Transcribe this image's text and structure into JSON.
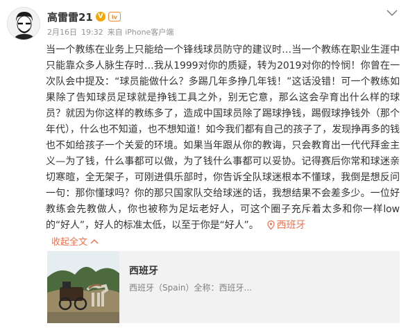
{
  "user": {
    "name": "高雷雷21",
    "verified_mark": "V",
    "level_badge": "lv",
    "avatar": "avatar-photo"
  },
  "meta": {
    "date": "2月16日",
    "time": "19:32",
    "source": "来自 iPhone客户端"
  },
  "post": {
    "text": "当一个教练在业务上只能给一个锋线球员防守的建议时…当一个教练在职业生涯中只能靠众多人脉生存时…我从1999对你的质疑，转为2019对你的怜悯！你曾在一次队会中提及：“球员能做什么？多踢几年多挣几年钱！”这话没错！可一个教练如果除了告知球员足球就是挣钱工具之外，别无它意，那么这会孕育出什么样的球员？就因为你这样的教练多了，造成中国球员除了踢球挣钱，踢假球挣钱外（那个年代），什么也不知道，也不想知道！如今我们都有自己的孩子了，发现挣再多的钱也不如给孩子一个关爱的环境。如果当年跟从你的教诲，只会教育出一代代拜金主义—为了钱，什么事都可以做，为了钱什么事都可以妥协。记得赛后你常和球迷亲切寒暄，全无架子，可刚进俱乐部时，你告诉全队球迷根本不懂球，我倒是想反问一句：那你懂球吗？你的那只国家队交给球迷的话，我想结果不会差多少。一位好教练会先教做人，你也被称为足坛老好人，可这个圈子充斥着太多和你一样low的“好人”，好人的标准太低，以至于你是“好人”。",
    "location": "西班牙",
    "expand_label": "收起全文"
  },
  "card": {
    "title": "西班牙",
    "description": "西班牙（Spain）全称：西班牙..."
  },
  "icons": {
    "top_right": "chevron-down-icon",
    "location": "location-pin-icon",
    "collapse": "chevron-up-icon"
  },
  "colors": {
    "accent": "#eb7350",
    "meta": "#939393",
    "text": "#333333",
    "card_bg": "#f2f2f2"
  }
}
